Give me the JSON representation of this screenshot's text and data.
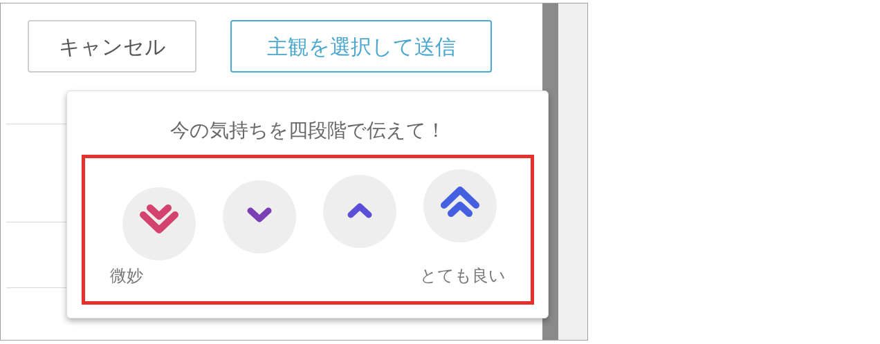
{
  "buttons": [
    {
      "label": "キャンセル",
      "kind": "cancel"
    },
    {
      "label": "主観を選択して送信",
      "kind": "primary"
    }
  ],
  "popup": {
    "title": "今の気持ちを四段階で伝えて！",
    "options": [
      {
        "kind": "double_down",
        "color": "#d4436f"
      },
      {
        "kind": "down",
        "color": "#7b3fb4"
      },
      {
        "kind": "up",
        "color": "#5a4fd6"
      },
      {
        "kind": "double_up",
        "color": "#4460e0"
      }
    ],
    "low_label": "微妙",
    "high_label": "とても良い"
  }
}
